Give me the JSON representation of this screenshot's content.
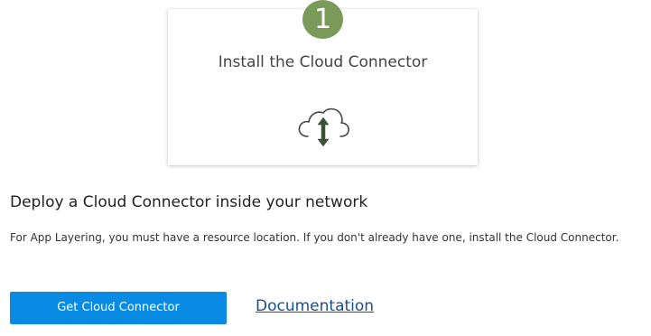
{
  "step_card": {
    "step_number": "1",
    "title": "Install the Cloud Connector",
    "icon": "cloud-upload-download-icon",
    "badge_color": "#7a9a5a"
  },
  "section": {
    "title": "Deploy a Cloud Connector inside your network",
    "description": "For App Layering, you must have a resource location. If you don't already have one, install the Cloud Connector."
  },
  "actions": {
    "primary_button_label": "Get Cloud Connector",
    "primary_button_color": "#0a8be3",
    "doc_link_label": "Documentation"
  }
}
